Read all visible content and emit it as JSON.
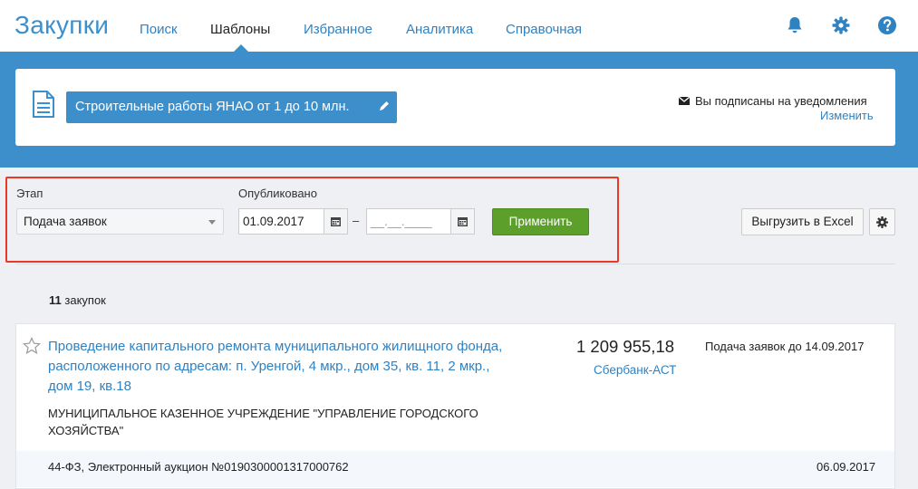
{
  "header": {
    "logo": "Закупки",
    "nav": [
      "Поиск",
      "Шаблоны",
      "Избранное",
      "Аналитика",
      "Справочная"
    ],
    "active_nav": "Шаблоны",
    "icons": [
      "bell-icon",
      "gear-icon",
      "help-icon"
    ],
    "accent": "#3d8fcb"
  },
  "template": {
    "name": "Строительные работы ЯНАО от 1 до 10 млн.",
    "subscription_text": "Вы подписаны на уведомления",
    "change_link": "Изменить"
  },
  "filters": {
    "stage_label": "Этап",
    "stage_value": "Подача заявок",
    "published_label": "Опубликовано",
    "date_from": "01.09.2017",
    "date_separator": "–",
    "date_to_placeholder": "__.__.____",
    "apply_label": "Применить",
    "export_label": "Выгрузить в Excel",
    "apply_color": "#5c9f2a"
  },
  "results": {
    "count": "11",
    "count_label": "закупок"
  },
  "item": {
    "title": "Проведение капитального ремонта муниципального жилищного фонда, расположенного по адресам: п. Уренгой, 4 мкр., дом 35, кв. 11, 2 мкр., дом 19, кв.18",
    "price": "1 209 955,18",
    "platform": "Сбербанк-АСТ",
    "deadline": "Подача заявок до 14.09.2017",
    "customer": "МУНИЦИПАЛЬНОЕ КАЗЕННОЕ УЧРЕЖДЕНИЕ \"УПРАВЛЕНИЕ ГОРОДСКОГО ХОЗЯЙСТВА\"",
    "law": "44-ФЗ, Электронный аукцион №0190300001317000762",
    "published": "06.09.2017"
  }
}
